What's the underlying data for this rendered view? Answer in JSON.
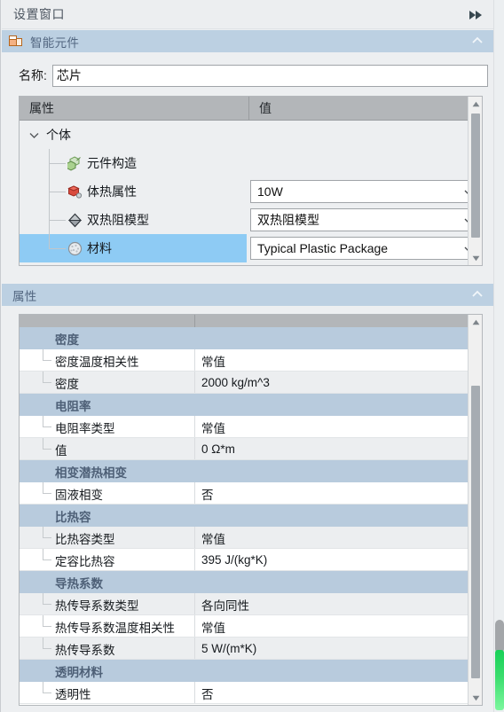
{
  "window": {
    "title": "设置窗口",
    "collapse_icon": "fast-forward-double-arrow-icon"
  },
  "smart_component_section": {
    "title": "智能元件",
    "icon": "smart-component-icon",
    "collapse_icon": "chevron-up-icon",
    "name_field": {
      "label": "名称:",
      "value": "芯片"
    },
    "tree": {
      "columns": [
        "属性",
        "值"
      ],
      "root": {
        "label": "个体",
        "expander_icon": "chevron-down-icon",
        "expanded": true
      },
      "nodes": [
        {
          "label": "元件构造",
          "icon": "green-cubes-icon",
          "value": null,
          "has_combo": false,
          "selected": false
        },
        {
          "label": "体热属性",
          "icon": "red-cube-icon",
          "value": "10W",
          "has_combo": true,
          "selected": false
        },
        {
          "label": "双热阻模型",
          "icon": "gray-diamond-icon",
          "value": "双热阻模型",
          "has_combo": true,
          "selected": false
        },
        {
          "label": "材料",
          "icon": "material-sphere-icon",
          "value": "Typical Plastic Package",
          "has_combo": true,
          "selected": true
        }
      ]
    }
  },
  "properties_section": {
    "title": "属性",
    "collapse_icon": "chevron-up-icon",
    "rows": [
      {
        "type": "group",
        "name": "密度",
        "value": ""
      },
      {
        "type": "leaf",
        "name": "密度温度相关性",
        "value": "常值"
      },
      {
        "type": "leaf",
        "name": "密度",
        "value": "2000 kg/m^3"
      },
      {
        "type": "group",
        "name": "电阻率",
        "value": ""
      },
      {
        "type": "leaf",
        "name": "电阻率类型",
        "value": "常值"
      },
      {
        "type": "leaf",
        "name": "值",
        "value": "0 Ω*m"
      },
      {
        "type": "group",
        "name": "相变潜热相变",
        "value": ""
      },
      {
        "type": "leaf",
        "name": "固液相变",
        "value": "否"
      },
      {
        "type": "group",
        "name": "比热容",
        "value": ""
      },
      {
        "type": "leaf",
        "name": "比热容类型",
        "value": "常值"
      },
      {
        "type": "leaf",
        "name": "定容比热容",
        "value": "395 J/(kg*K)"
      },
      {
        "type": "group",
        "name": "导热系数",
        "value": ""
      },
      {
        "type": "leaf",
        "name": "热传导系数类型",
        "value": "各向同性"
      },
      {
        "type": "leaf",
        "name": "热传导系数温度相关性",
        "value": "常值"
      },
      {
        "type": "leaf",
        "name": "热传导系数",
        "value": "5 W/(m*K)"
      },
      {
        "type": "group",
        "name": "透明材料",
        "value": ""
      },
      {
        "type": "leaf",
        "name": "透明性",
        "value": "否"
      }
    ]
  },
  "colors": {
    "section_header": "#bcd0e2",
    "table_header": "#b3b6b9",
    "group_row": "#b8cbdd",
    "selection": "#8ecbf4",
    "scroll_thumb_green": "#2ed15f",
    "panel_bg": "#edeff1"
  }
}
